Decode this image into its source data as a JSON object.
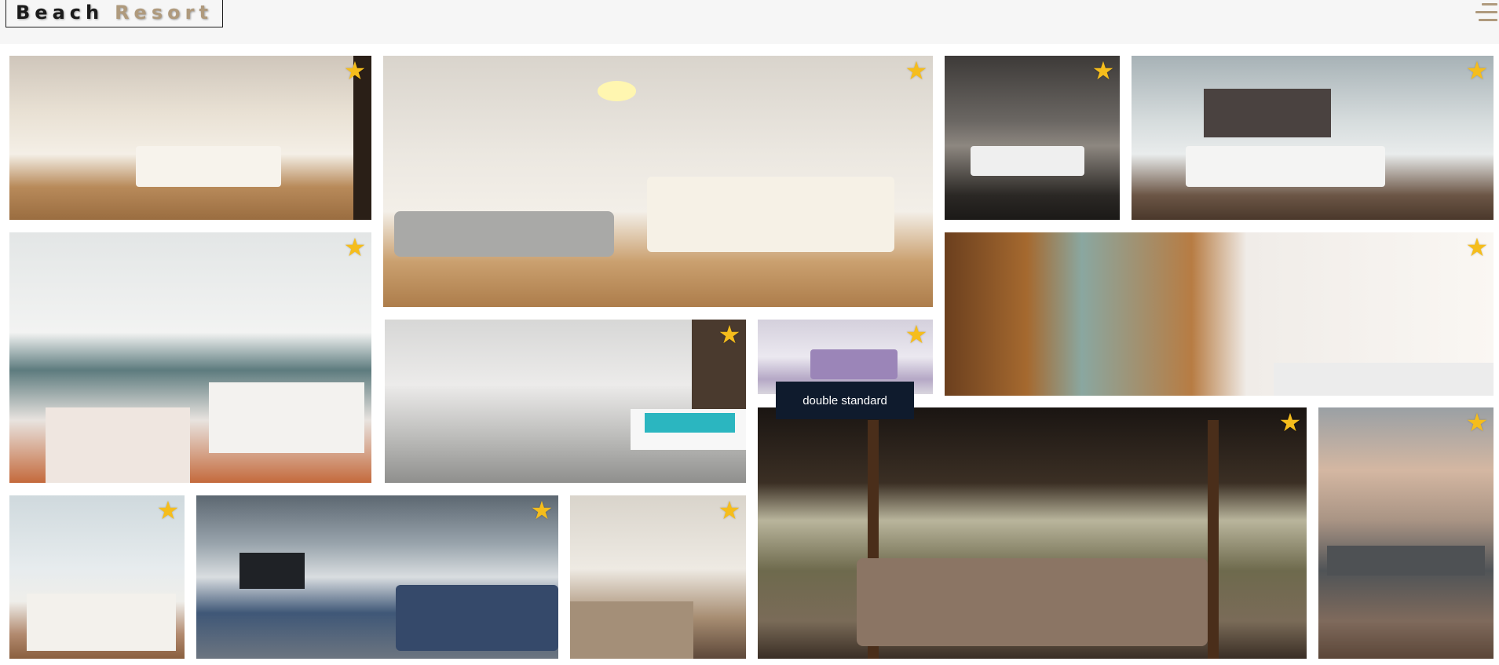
{
  "header": {
    "logo_word1": "Beach",
    "logo_word2": "Resort",
    "menu_icon": "hamburger-menu-icon"
  },
  "colors": {
    "accent_gold": "#af9a7d",
    "star": "#f5bd1c",
    "tooltip_bg": "#0f1b2d"
  },
  "gallery": {
    "tooltip_text": "double standard",
    "star_icon": "star-icon"
  }
}
